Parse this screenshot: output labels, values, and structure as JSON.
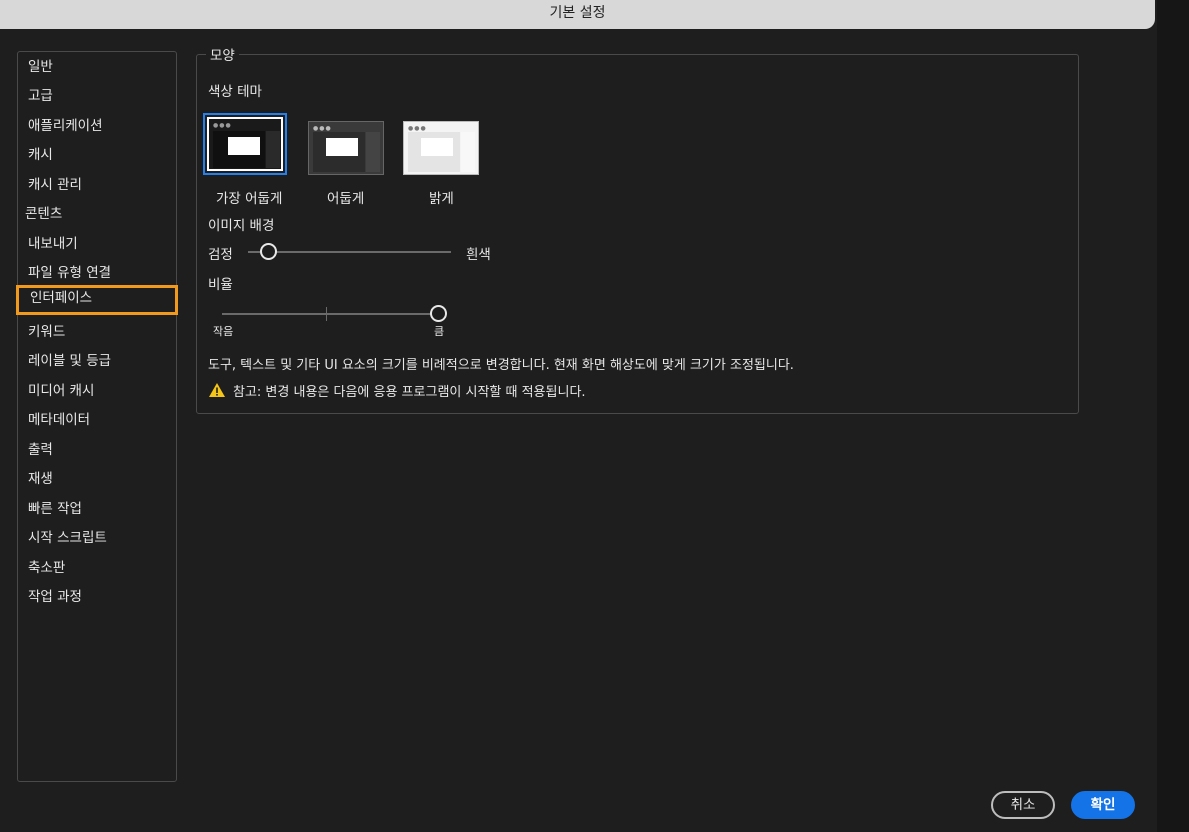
{
  "window": {
    "title": "기본 설정"
  },
  "sidebar": {
    "items": [
      {
        "label": "일반"
      },
      {
        "label": "고급"
      },
      {
        "label": "애플리케이션"
      },
      {
        "label": "캐시"
      },
      {
        "label": "캐시 관리"
      },
      {
        "label": "콘텐츠"
      },
      {
        "label": "내보내기"
      },
      {
        "label": "파일 유형 연결"
      },
      {
        "label": "인터페이스"
      },
      {
        "label": "키워드"
      },
      {
        "label": "레이블 및 등급"
      },
      {
        "label": "미디어 캐시"
      },
      {
        "label": "메타데이터"
      },
      {
        "label": "출력"
      },
      {
        "label": "재생"
      },
      {
        "label": "빠른 작업"
      },
      {
        "label": "시작 스크립트"
      },
      {
        "label": "축소판"
      },
      {
        "label": "작업 과정"
      }
    ],
    "selected": "인터페이스"
  },
  "appearance": {
    "group_title": "모양",
    "color_theme_label": "색상 테마",
    "themes": [
      {
        "label": "가장 어둡게",
        "selected": true
      },
      {
        "label": "어둡게",
        "selected": false
      },
      {
        "label": "밝게",
        "selected": false
      }
    ],
    "image_background": {
      "label": "이미지 배경",
      "min_label": "검정",
      "max_label": "흰색",
      "value": 0.1
    },
    "scale": {
      "label": "비율",
      "min_label": "작음",
      "max_label": "큼",
      "value": 1.0
    },
    "description": "도구, 텍스트 및 기타 UI 요소의 크기를 비례적으로 변경합니다. 현재 화면 해상도에 맞게 크기가 조정됩니다.",
    "note": "참고: 변경 내용은 다음에 응용 프로그램이 시작할 때 적용됩니다."
  },
  "buttons": {
    "cancel": "취소",
    "ok": "확인"
  },
  "colors": {
    "accent": "#1473e6",
    "selection": "#f29a1d",
    "warning": "#f5c518"
  },
  "icons": {
    "warning": "warning-icon"
  }
}
